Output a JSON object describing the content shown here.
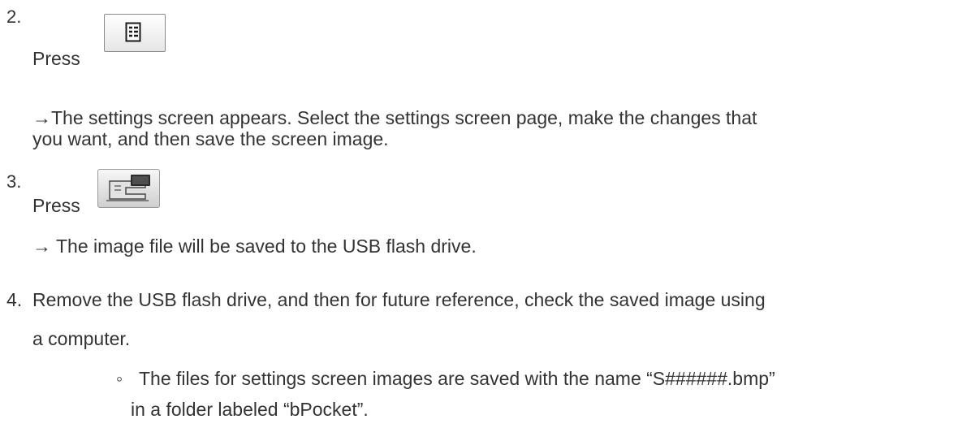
{
  "steps": [
    {
      "number": "2.",
      "label": "Press",
      "icon": "settings-icon",
      "result_lines": [
        "→The settings screen appears. Select the settings screen page, make the changes that",
        "you want, and then save the screen image."
      ]
    },
    {
      "number": "3.",
      "label": "Press",
      "icon": "embroidery-machine-icon",
      "result_lines": [
        "→ The image file will be saved to the USB flash drive."
      ]
    },
    {
      "number": "4.",
      "text_lines": [
        "Remove the USB flash drive, and then for future reference, check the saved image using",
        "a computer."
      ]
    }
  ],
  "note": {
    "bullet": "◦",
    "lines": [
      "The files for settings screen images are saved with the name “S######.bmp”",
      "in a folder labeled “bPocket”."
    ]
  }
}
